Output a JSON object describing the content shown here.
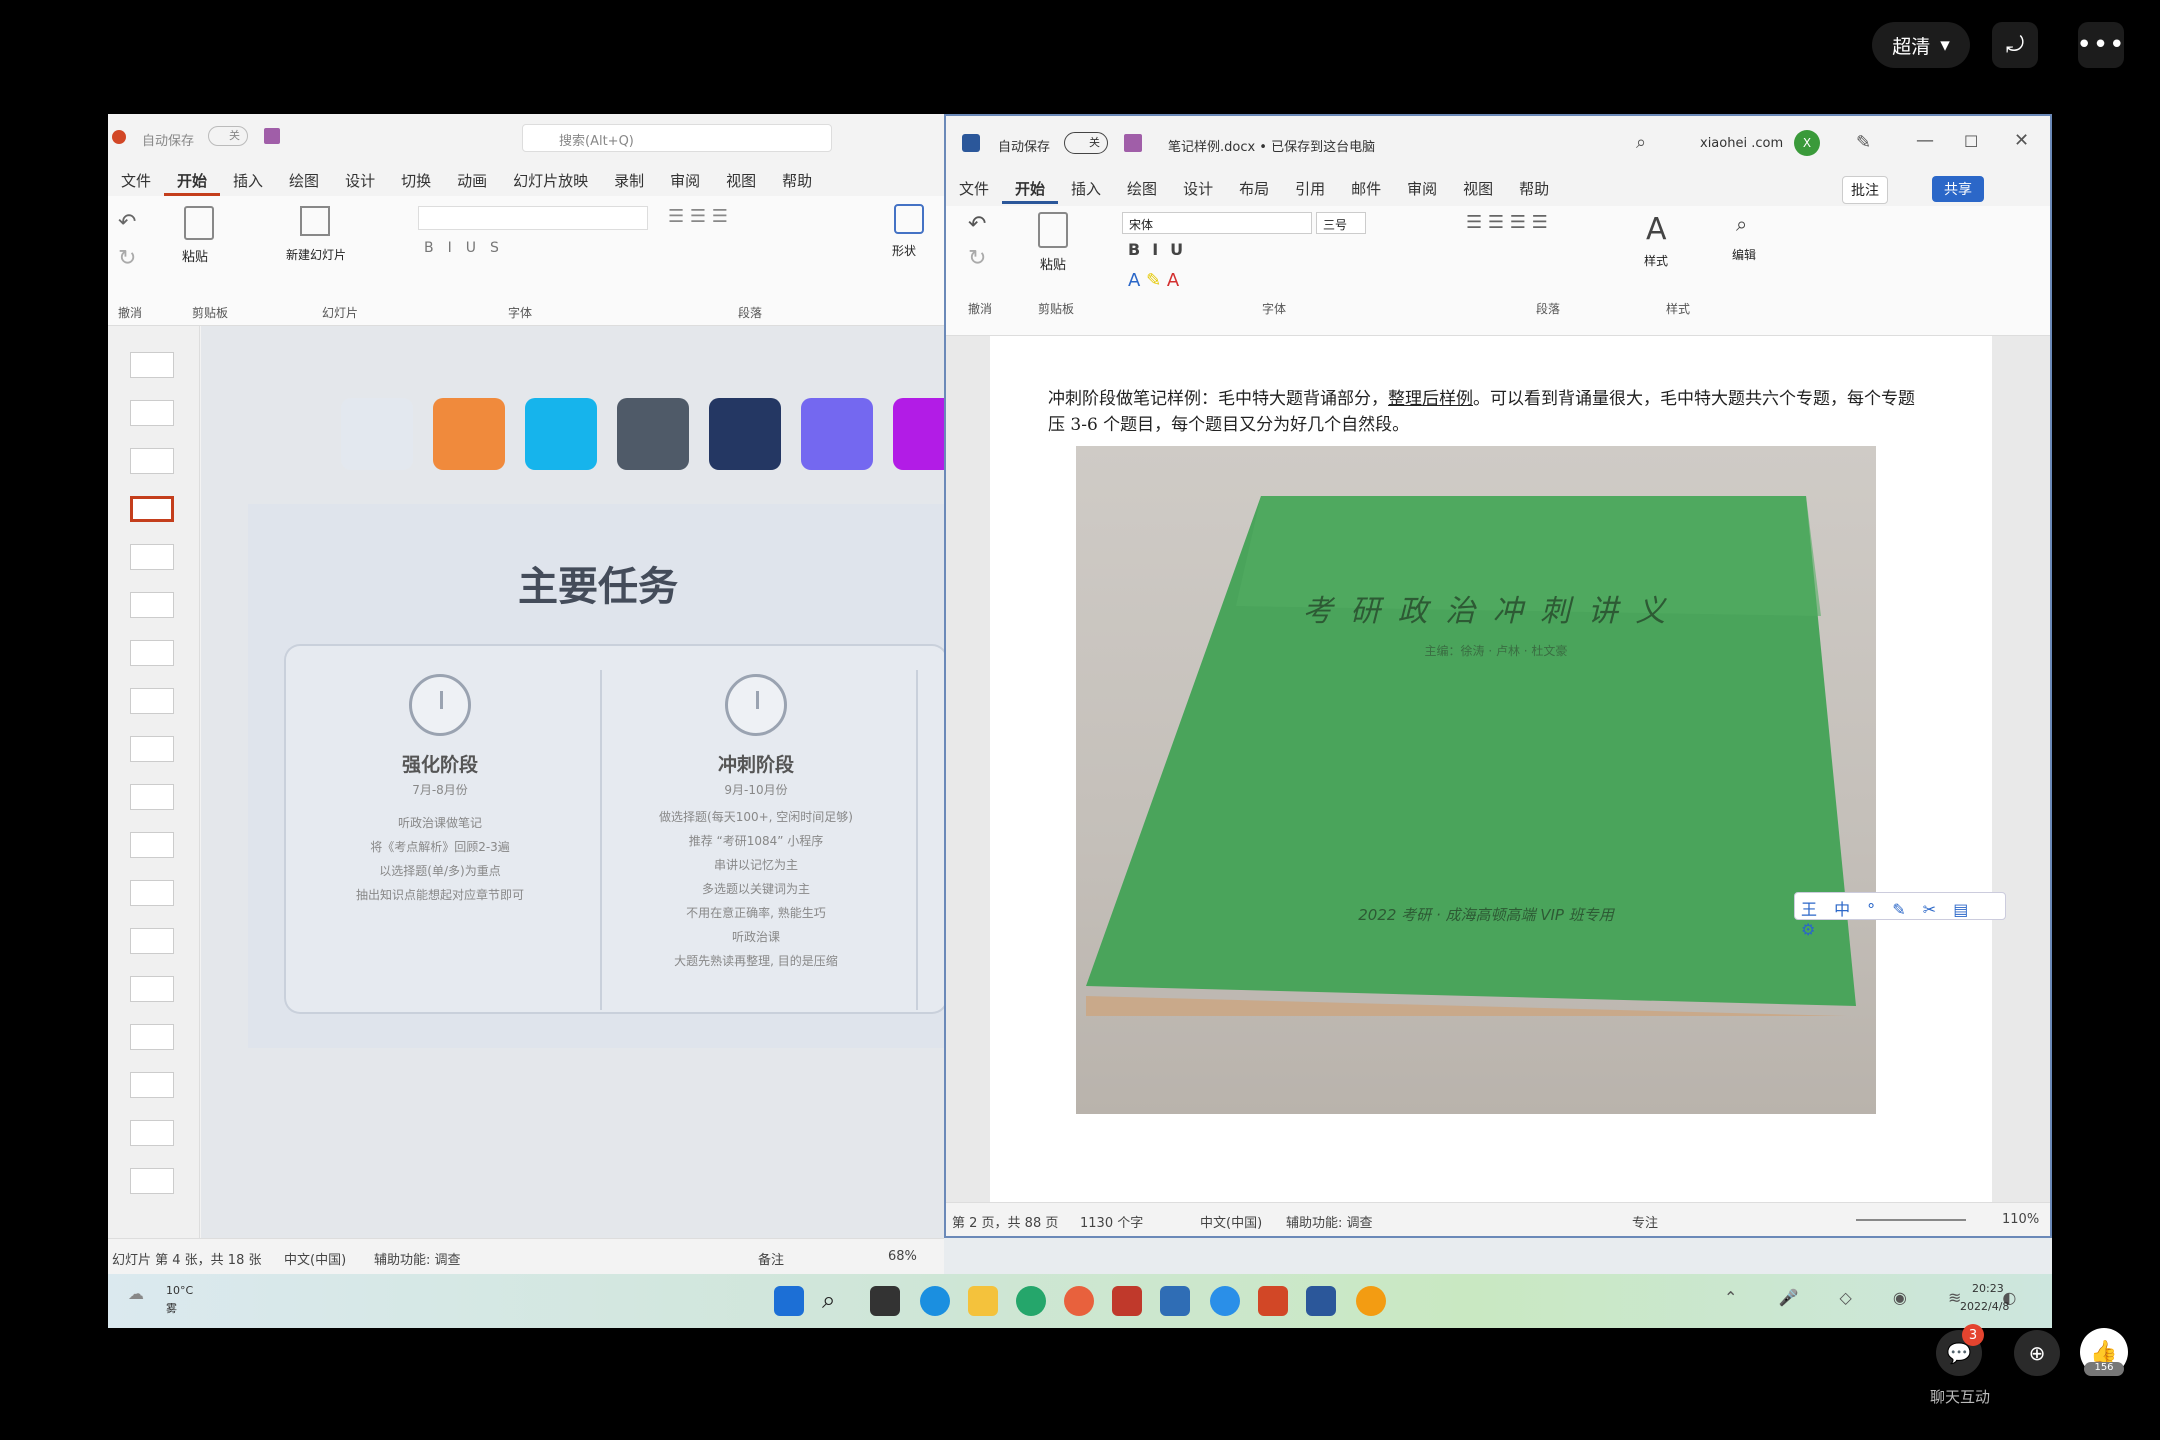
{
  "overlay": {
    "quality_label": "超清",
    "chat_label": "聊天互动",
    "chat_badge": "3",
    "like_count": "156"
  },
  "ppt": {
    "title_autosave": "自动保存",
    "title_toggle": "关",
    "search_placeholder": "搜索(Alt+Q)",
    "tabs": [
      "文件",
      "开始",
      "插入",
      "绘图",
      "设计",
      "切换",
      "动画",
      "幻灯片放映",
      "录制",
      "审阅",
      "视图",
      "帮助"
    ],
    "groups": [
      "撤消",
      "剪贴板",
      "幻灯片",
      "字体",
      "段落"
    ],
    "ribbon_btns": {
      "paste": "粘贴",
      "new_slide": "新建幻灯片",
      "shape": "形状"
    },
    "swatches": [
      "#e3e8ef",
      "#f08a3c",
      "#16b4ec",
      "#4f5a68",
      "#243763",
      "#7468f0",
      "#b21ce6"
    ],
    "slide": {
      "title": "主要任务",
      "col1": {
        "title": "强化阶段",
        "date": "7月-8月份",
        "lines": [
          "听政治课做笔记",
          "将《考点解析》回顾2-3遍",
          "以选择题(单/多)为重点",
          "抽出知识点能想起对应章节即可"
        ]
      },
      "col2": {
        "title": "冲刺阶段",
        "date": "9月-10月份",
        "lines": [
          "做选择题(每天100+, 空闲时间足够)",
          "推荐 “考研1084” 小程序",
          "串讲以记忆为主",
          "多选题以关键词为主",
          "不用在意正确率, 熟能生巧",
          "听政治课",
          "大题先熟读再整理, 目的是压缩"
        ]
      }
    },
    "status": {
      "slide_info": "幻灯片 第 4 张，共 18 张",
      "lang": "中文(中国)",
      "accessibility": "辅助功能: 调查",
      "notes": "备注",
      "zoom": "68%"
    }
  },
  "word": {
    "autosave": "自动保存",
    "toggle": "关",
    "doc_title": "笔记样例.docx • 已保存到这台电脑",
    "user": "xiaohei .com",
    "avatar": "X",
    "tabs": [
      "文件",
      "开始",
      "插入",
      "绘图",
      "设计",
      "布局",
      "引用",
      "邮件",
      "审阅",
      "视图",
      "帮助"
    ],
    "comment_btn": "批注",
    "share_btn": "共享",
    "font_name": "宋体",
    "font_size": "三号",
    "groups": [
      "撤消",
      "剪贴板",
      "字体",
      "段落",
      "样式",
      "编辑"
    ],
    "ribbon_btns": {
      "paste": "粘贴",
      "styles": "样式",
      "edit": "编辑"
    },
    "para_prefix": "冲刺阶段做笔记样例：毛中特大题背诵部分，",
    "para_link": "整理后样例",
    "para_suffix": "。可以看到背诵量很大，毛中特大题共六个专题，每个专题压 3-6 个题目，每个题目又分为好几个自然段。",
    "book_title": "考 研 政 治 冲 刺 讲 义",
    "book_authors": "主编：徐涛 · 卢林 · 杜文豪",
    "book_footer": "2022 考研 · 成海高顿高端 VIP 班专用",
    "status": {
      "page": "第 2 页，共 88 页",
      "words": "1130 个字",
      "lang": "中文(中国)",
      "accessibility": "辅助功能: 调查",
      "focus": "专注",
      "zoom": "110%"
    }
  },
  "taskbar": {
    "weather_temp": "10°C",
    "weather_desc": "雾",
    "time": "20:23",
    "date": "2022/4/8"
  }
}
